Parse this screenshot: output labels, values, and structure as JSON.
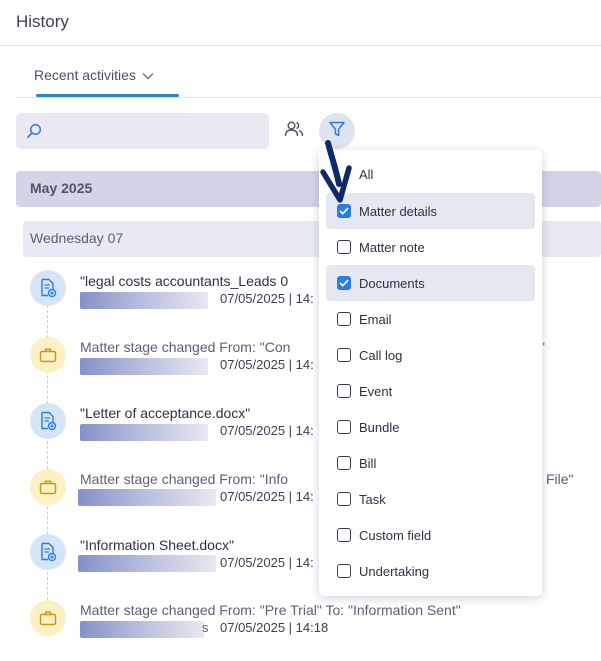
{
  "header": {
    "title": "History"
  },
  "tabs": {
    "active_label": "Recent activities"
  },
  "search": {
    "value": "",
    "placeholder": ""
  },
  "colors": {
    "accent": "#2b7de1",
    "month_bar": "#d2d5e5",
    "day_bar": "#e8e9f3",
    "doc_icon_bg": "#d6e4f7",
    "stage_icon_bg": "#fbf1c4"
  },
  "icons": {
    "search": "search-icon",
    "people": "people-icon",
    "filter": "filter-icon",
    "document": "document-add-icon",
    "briefcase": "briefcase-icon",
    "chevron": "chevron-down-icon",
    "annotation": "arrow-down-icon"
  },
  "timeline": {
    "month": "May 2025",
    "day": "Wednesday 07",
    "activities": [
      {
        "type": "document",
        "title": "\"legal costs accountants_Leads 0",
        "date": "07/05/2025 | 14:"
      },
      {
        "type": "stage",
        "title": "Matter stage changed From: \"Con",
        "title_tail": "\"",
        "date": "07/05/2025 | 14:"
      },
      {
        "type": "document",
        "title": "\"Letter of acceptance.docx\"",
        "date": "07/05/2025 | 14:"
      },
      {
        "type": "stage",
        "title": "Matter stage changed From: \"Info",
        "title_tail": "File\"",
        "date": "07/05/2025 | 14:"
      },
      {
        "type": "document",
        "title": "\"Information Sheet.docx\"",
        "date": "07/05/2025 | 14:"
      },
      {
        "type": "stage",
        "title": "Matter stage changed From: \"Pre Trial\" To: \"Information Sent\"",
        "date": "07/05/2025 | 14:18",
        "blur_suffix": "s"
      }
    ]
  },
  "filter_menu": {
    "options": [
      {
        "label": "All",
        "checked": false,
        "checkbox": false
      },
      {
        "label": "Matter details",
        "checked": true
      },
      {
        "label": "Matter note",
        "checked": false
      },
      {
        "label": "Documents",
        "checked": true
      },
      {
        "label": "Email",
        "checked": false
      },
      {
        "label": "Call log",
        "checked": false
      },
      {
        "label": "Event",
        "checked": false
      },
      {
        "label": "Bundle",
        "checked": false
      },
      {
        "label": "Bill",
        "checked": false
      },
      {
        "label": "Task",
        "checked": false
      },
      {
        "label": "Custom field",
        "checked": false
      },
      {
        "label": "Undertaking",
        "checked": false
      }
    ]
  }
}
